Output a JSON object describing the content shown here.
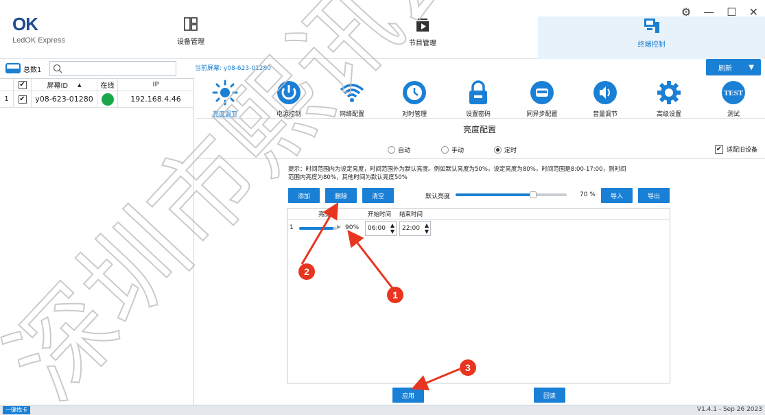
{
  "app": {
    "logo_mark": "OK",
    "name": "LedOK Express",
    "window_controls": [
      "⚙",
      "—",
      "☐",
      "✕"
    ]
  },
  "nav": {
    "tabs": [
      {
        "label": "设备管理",
        "icon": "device-manage-icon"
      },
      {
        "label": "节目管理",
        "icon": "program-manage-icon"
      },
      {
        "label": "终端控制",
        "icon": "terminal-control-icon",
        "active": true
      }
    ]
  },
  "left": {
    "total_label": "总数1",
    "search": {
      "value": "",
      "placeholder": ""
    },
    "columns": [
      "",
      "屏幕ID",
      "在线",
      "IP"
    ],
    "rows": [
      {
        "index": "1",
        "checked": "✔",
        "screen_id": "y08-623-01280",
        "ip": "192.168.4.46"
      }
    ]
  },
  "current_screen": "当前屏幕: y08-623-01280",
  "refresh_label": "刷新",
  "functions": [
    {
      "label": "亮度调节",
      "icon": "brightness-icon",
      "active": true
    },
    {
      "label": "电源控制",
      "icon": "power-icon"
    },
    {
      "label": "网络配置",
      "icon": "wifi-icon"
    },
    {
      "label": "对时管理",
      "icon": "clock-sync-icon"
    },
    {
      "label": "设置密码",
      "icon": "lock-icon"
    },
    {
      "label": "同异步配置",
      "icon": "sync-async-icon"
    },
    {
      "label": "音量调节",
      "icon": "volume-icon"
    },
    {
      "label": "高级设置",
      "icon": "gear-icon"
    },
    {
      "label": "测试",
      "icon": "test-icon",
      "icon_text": "TEST"
    }
  ],
  "brightness": {
    "title": "亮度配置",
    "modes": [
      {
        "label": "自动",
        "selected": false
      },
      {
        "label": "手动",
        "selected": false
      },
      {
        "label": "定时",
        "selected": true
      }
    ],
    "compat_label": "适配旧设备",
    "compat_checked": "✔",
    "hint_line1": "提示：时间范围内为设定亮度，时间范围外为默认亮度。例如默认亮度为50%，设定亮度为80%，时间范围是8:00-17:00，则时间",
    "hint_line2": "范围内亮度为80%，其他时间为默认亮度50%",
    "buttons": {
      "add": "添加",
      "delete": "删除",
      "clear": "清空",
      "import": "导入",
      "export": "导出",
      "apply": "应用",
      "readback": "回读"
    },
    "default_label": "默认亮度",
    "default_value": 70,
    "default_value_text": "70 %",
    "table_headers": {
      "value": "亮度值",
      "start": "开始时间",
      "end": "结束时间"
    },
    "schedule": [
      {
        "index": "1",
        "value": 90,
        "value_text": "90%",
        "start": "06:00",
        "end": "22:00"
      }
    ]
  },
  "annotations": [
    "1",
    "2",
    "3"
  ],
  "watermark_text": "深圳市熙讯云科",
  "status": {
    "onekey_label": "一键找卡",
    "version": "V1.4.1 - Sep 26 2023"
  },
  "colors": {
    "accent": "#1a80d6",
    "online": "#1aa84b",
    "annotation": "#e8351f"
  }
}
